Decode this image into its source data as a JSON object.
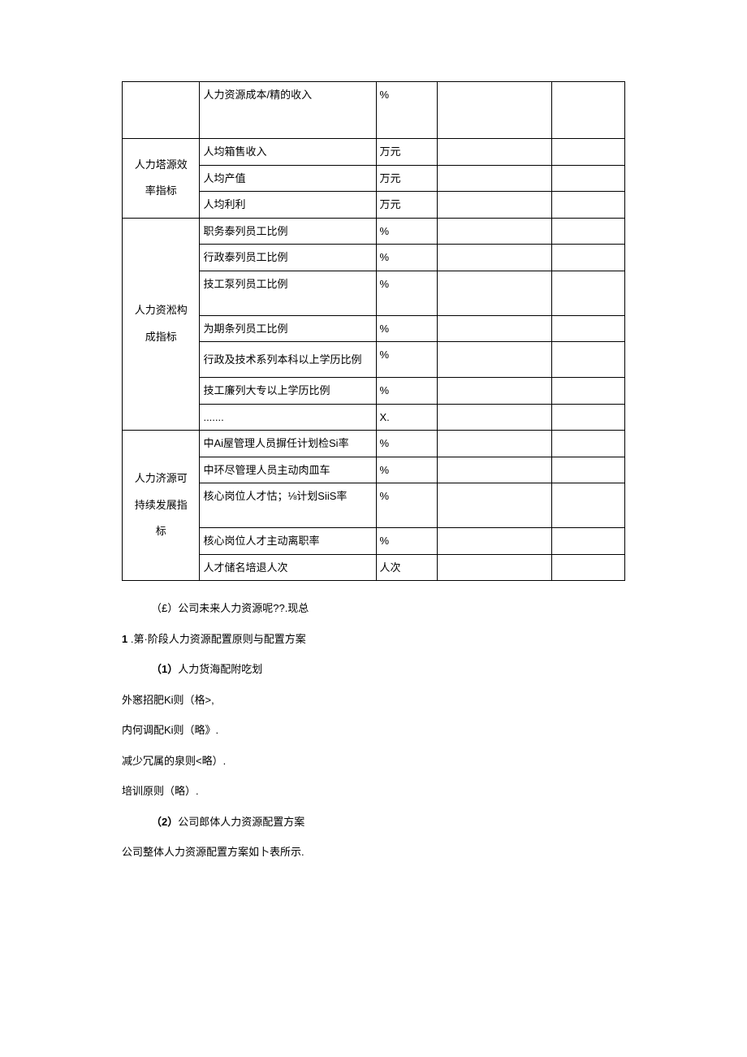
{
  "table": {
    "cat0": "",
    "row0": {
      "metric": "人力资源成本/精的收入",
      "unit": "%"
    },
    "cat1": "人力塔源效\n率指标",
    "row1": {
      "metric": "人均箱售收入",
      "unit": "万元"
    },
    "row2": {
      "metric": "人均产值",
      "unit": "万元"
    },
    "row3": {
      "metric": "人均利利",
      "unit": "万元"
    },
    "cat2": "人力资淞构\n成指标",
    "row4": {
      "metric": "职务泰列员工比例",
      "unit": "%"
    },
    "row5": {
      "metric": "行政泰列员工比例",
      "unit": "%"
    },
    "row6": {
      "metric": "技工泵列员工比例",
      "unit": "%"
    },
    "row7": {
      "metric": "为期条列员工比例",
      "unit": "%"
    },
    "row8": {
      "metric": "行政及技术系列本科以上学历比例",
      "unit": "%"
    },
    "row9": {
      "metric": "技工廉列大专以上学历比例",
      "unit": "%"
    },
    "row10": {
      "metric": ".......",
      "unit": "X."
    },
    "cat3": "人力济源可\n持续发展指\n标",
    "row11": {
      "metric": "中Ai屋管理人员摒任计划检Si率",
      "unit": "%"
    },
    "row12": {
      "metric": "中环尽管理人员主动肉皿车",
      "unit": "%"
    },
    "row13": {
      "metric": "核心岗位人才怙；⅛计划SiiS率",
      "unit": "%"
    },
    "row14": {
      "metric": "核心岗位人才主动离职率",
      "unit": "%"
    },
    "row15": {
      "metric": "人才储名培退人次",
      "unit": "人次"
    }
  },
  "text": {
    "p1": "（£）公司未来人力资源呢??.现总",
    "p2_num": "1",
    "p2_rest": " .第·阶段人力资源配置原则与配置方案",
    "p3_num": "（1）",
    "p3_rest": "人力货海配附吃划",
    "p4": "外窸招肥Ki则（格>,",
    "p5": "内何调配Ki则（略》.",
    "p6": "减少冗属的泉则<略）.",
    "p7": "培训原则（略）.",
    "p8_num": "（2）",
    "p8_rest": "公司郎体人力资源配置方案",
    "p9": "公司整体人力资源配置方案如卜表所示."
  }
}
